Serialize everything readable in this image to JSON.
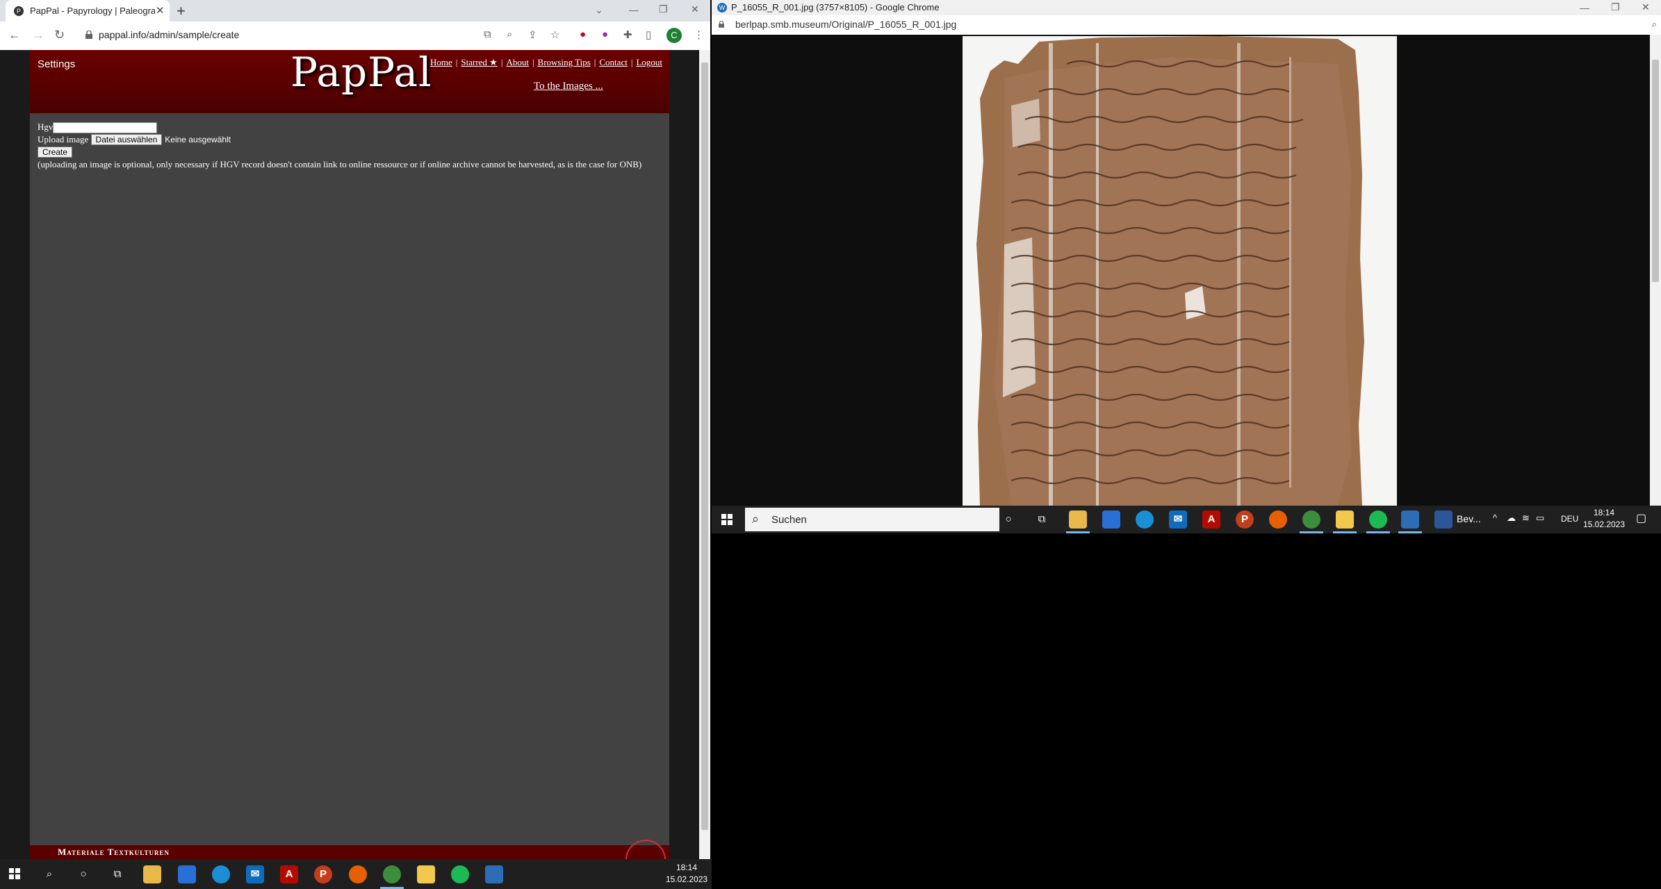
{
  "left_browser": {
    "tab_title": "PapPal - Papyrology | Paleograph...",
    "new_tab": "+",
    "url": "pappal.info/admin/sample/create",
    "avatar_letter": "C"
  },
  "page": {
    "settings": "Settings",
    "logo": "PapPal",
    "nav": {
      "home": "Home",
      "starred": "Starred ★",
      "about": "About",
      "browsing_tips": "Browsing Tips",
      "contact": "Contact",
      "logout": "Logout",
      "separator": "|"
    },
    "to_images": "To the Images ...",
    "form": {
      "hgv_label": "Hgv",
      "upload_label": "Upload image",
      "choose_file_button": "Datei auswählen",
      "no_file_text": "Keine ausgewählt",
      "create_button": "Create",
      "note": "(uploading an image is optional, only necessary if HGV record doesn't contain link to online ressource or if online archive cannot be harvested, as is the case for ONB)"
    },
    "footer_text": "Materiale Textkulturen",
    "colors": {
      "header": "#6b0000",
      "page_bg": "#424242"
    }
  },
  "right_browser": {
    "window_title": "P_16055_R_001.jpg (3757×8105) - Google Chrome",
    "url": "berlpap.smb.museum/Original/P_16055_R_001.jpg"
  },
  "taskbar_left": {
    "time": "18:14",
    "date": "15.02.2023"
  },
  "taskbar_right": {
    "search_placeholder": "Suchen",
    "app_label": "Bev...",
    "language": "DEU",
    "time": "18:14",
    "date": "15.02.2023"
  }
}
